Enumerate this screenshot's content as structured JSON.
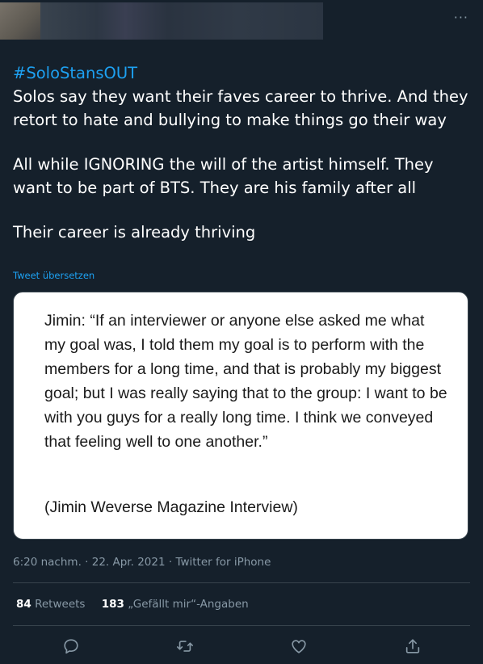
{
  "header": {
    "more_label": "···"
  },
  "tweet": {
    "hashtag": "#SoloStansOUT",
    "paragraphs": [
      "Solos say they want their faves career to thrive. And they retort to hate and bullying to make things go their way",
      "All while IGNORING the will of the artist himself. They want to be part of BTS. They are his family after all",
      "Their career is already thriving"
    ],
    "translate_label": "Tweet übersetzen"
  },
  "image_card": {
    "quote": "Jimin: “If an interviewer or anyone else asked me what my goal was, I told them my goal is to perform with the members for a long time, and that is probably my biggest goal; but I was really saying that to the group: I want to be with you guys for a really long time. I think we conveyed that feeling well to one another.”",
    "source": "(Jimin Weverse Magazine Interview)"
  },
  "meta": {
    "time": "6:20 nachm.",
    "separator": " · ",
    "date": "22. Apr. 2021",
    "client": "Twitter for iPhone"
  },
  "stats": {
    "retweets_count": "84",
    "retweets_label": "Retweets",
    "likes_count": "183",
    "likes_label": "„Gefällt mir“-Angaben"
  },
  "actions": {
    "reply_icon": "reply-icon",
    "retweet_icon": "retweet-icon",
    "like_icon": "heart-icon",
    "share_icon": "share-icon"
  },
  "colors": {
    "background": "#15202b",
    "accent": "#1da1f2",
    "muted": "#8899a6",
    "divider": "#38444d"
  }
}
